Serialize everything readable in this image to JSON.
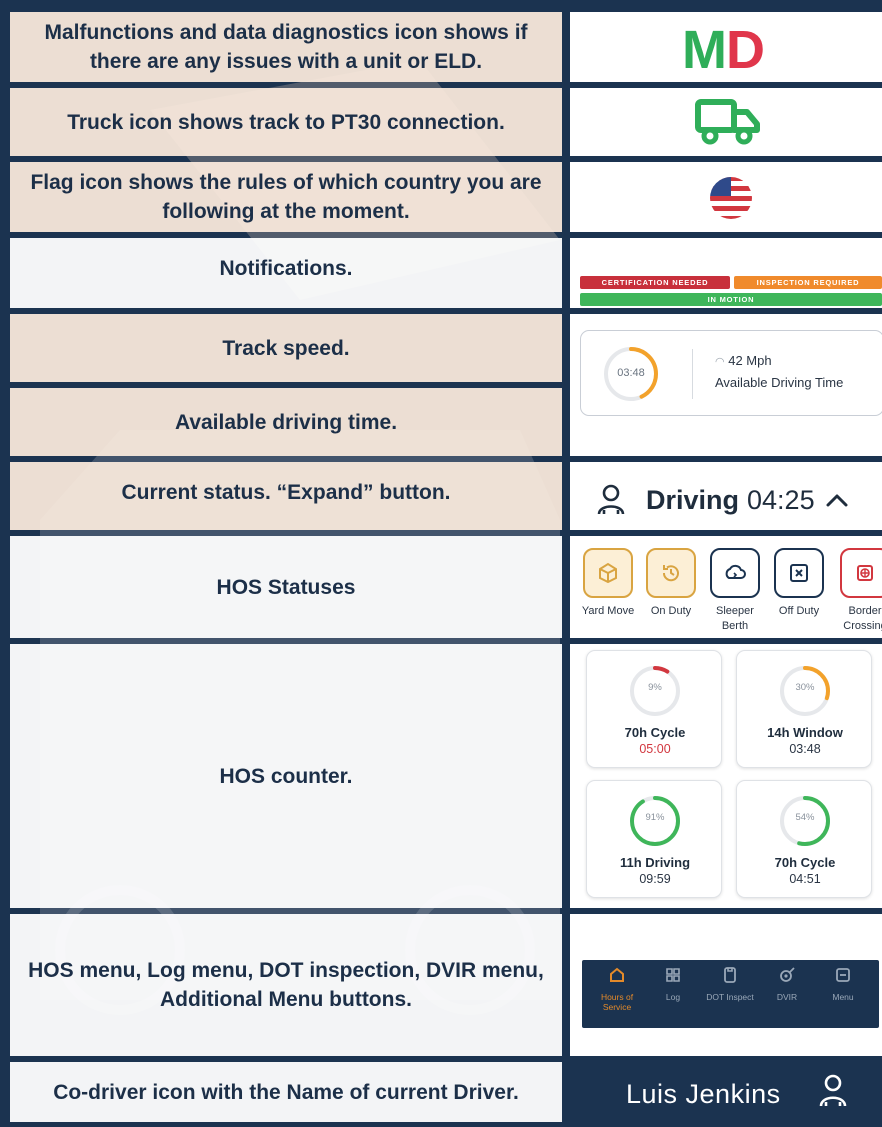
{
  "colors": {
    "navy": "#1b3350",
    "green": "#2fae59",
    "red": "#e0364b",
    "orange": "#f3a22b"
  },
  "rows": [
    {
      "description": "Malfunctions and data diagnostics icon shows if there are any issues with a unit or ELD."
    },
    {
      "description": "Truck icon shows track to PT30 connection."
    },
    {
      "description": "Flag icon shows the rules of which country you are following at the moment."
    },
    {
      "description": "Notifications."
    },
    {
      "description": "Track speed."
    },
    {
      "description": "Available driving time."
    },
    {
      "description": "Current status. “Expand” button."
    },
    {
      "description": "HOS Statuses"
    },
    {
      "description": "HOS counter."
    },
    {
      "description": "HOS menu, Log menu,  DOT inspection, DVIR menu, Additional Menu buttons."
    },
    {
      "description": "Co-driver icon with the Name of current Driver."
    }
  ],
  "md_logo": {
    "m": "M",
    "d": "D"
  },
  "icons": {
    "truck": "truck-icon",
    "flag": "us-flag-icon",
    "driver": "driver-person-icon",
    "expand": "chevron-up-icon"
  },
  "notifications": {
    "certification": "CERTIFICATION NEEDED",
    "inspection": "INSPECTION REQUIRED",
    "motion": "IN MOTION"
  },
  "speed_card": {
    "ring_time": "03:48",
    "ring_progress": 0.43,
    "speed": "42 Mph",
    "label": "Available Driving Time"
  },
  "current_status": {
    "status": "Driving",
    "time": "04:25"
  },
  "hos_statuses": [
    {
      "label": "Yard Move",
      "icon": "yard-move-icon",
      "color": "#d9a441"
    },
    {
      "label": "On Duty",
      "icon": "on-duty-icon",
      "color": "#d9a441"
    },
    {
      "label": "Sleeper Berth",
      "icon": "sleeper-berth-icon",
      "color": "#1b3350"
    },
    {
      "label": "Off Duty",
      "icon": "off-duty-icon",
      "color": "#1b3350"
    },
    {
      "label": "Border Crossing",
      "icon": "border-crossing-icon",
      "color": "#d2373f"
    }
  ],
  "hos_counters": [
    {
      "percent": "9%",
      "progress": 0.09,
      "name": "70h Cycle",
      "time": "05:00",
      "ring_color": "#d2373f",
      "time_color": "#d2373f"
    },
    {
      "percent": "30%",
      "progress": 0.3,
      "name": "14h Window",
      "time": "03:48",
      "ring_color": "#f3a22b",
      "time_color": "#2a3544"
    },
    {
      "percent": "91%",
      "progress": 0.91,
      "name": "11h Driving",
      "time": "09:59",
      "ring_color": "#3fb65a",
      "time_color": "#2a3544"
    },
    {
      "percent": "54%",
      "progress": 0.54,
      "name": "70h Cycle",
      "time": "04:51",
      "ring_color": "#3fb65a",
      "time_color": "#2a3544"
    }
  ],
  "nav": [
    {
      "label": "Hours of Service",
      "icon": "home-icon",
      "active": true
    },
    {
      "label": "Log",
      "icon": "log-icon",
      "active": false
    },
    {
      "label": "DOT Inspect",
      "icon": "dot-inspect-icon",
      "active": false
    },
    {
      "label": "DVIR",
      "icon": "dvir-icon",
      "active": false
    },
    {
      "label": "Menu",
      "icon": "menu-icon",
      "active": false
    }
  ],
  "driver": {
    "name": "Luis Jenkins"
  }
}
